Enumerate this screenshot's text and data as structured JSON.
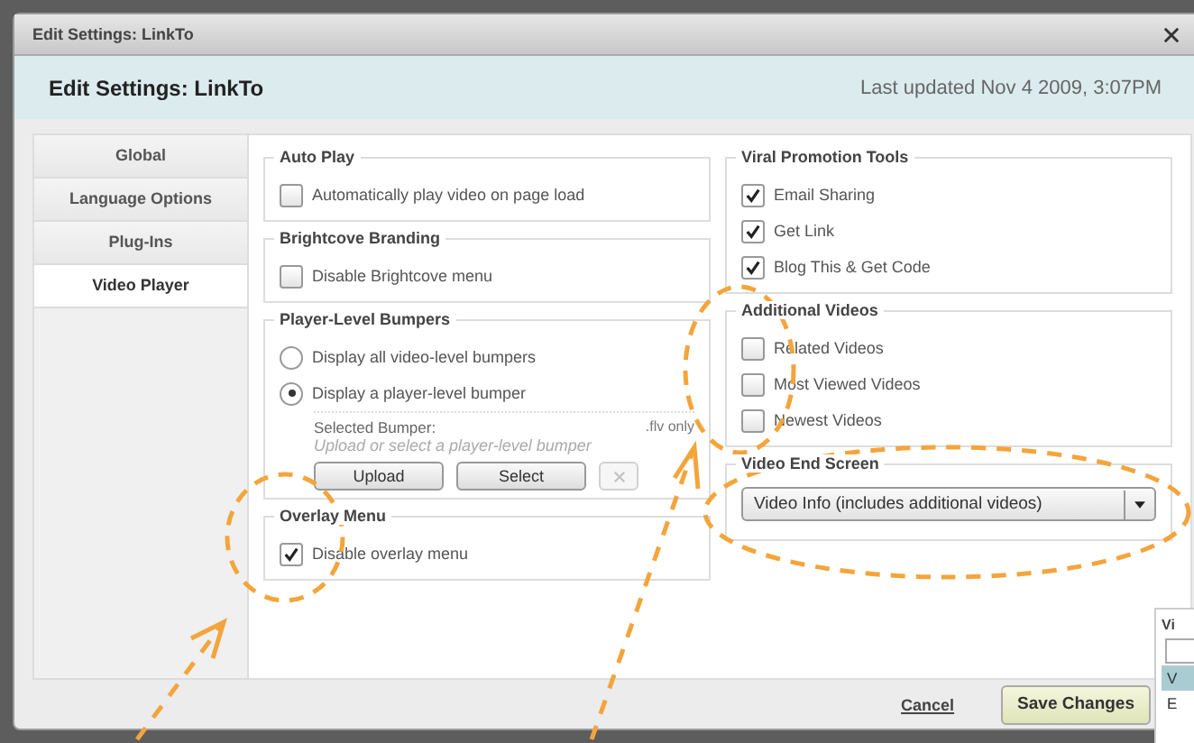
{
  "dialog": {
    "title_bar": "Edit Settings: LinkTo",
    "heading": "Edit Settings: LinkTo",
    "last_updated": "Last updated Nov 4 2009, 3:07PM"
  },
  "tabs": [
    {
      "label": "Global",
      "selected": false
    },
    {
      "label": "Language Options",
      "selected": false
    },
    {
      "label": "Plug-Ins",
      "selected": false
    },
    {
      "label": "Video Player",
      "selected": true
    }
  ],
  "columns": [
    [
      {
        "kind": "checkboxes",
        "title": "Auto Play",
        "items": [
          {
            "label": "Automatically play video on page load",
            "checked": false
          }
        ]
      },
      {
        "kind": "checkboxes",
        "title": "Brightcove Branding",
        "items": [
          {
            "label": "Disable Brightcove menu",
            "checked": false
          }
        ]
      },
      {
        "kind": "radios",
        "title": "Player-Level Bumpers",
        "items": [
          {
            "label": "Display all video-level bumpers",
            "selected": false
          },
          {
            "label": "Display a player-level bumper",
            "selected": true
          }
        ],
        "bumper": {
          "label": "Selected Bumper:",
          "note": ".flv only",
          "placeholder": "Upload or select a player-level bumper",
          "buttons": [
            "Upload",
            "Select"
          ],
          "clear_disabled": true
        }
      },
      {
        "kind": "checkboxes",
        "title": "Overlay Menu",
        "items": [
          {
            "label": "Disable overlay menu",
            "checked": true
          }
        ]
      }
    ],
    [
      {
        "kind": "checkboxes",
        "title": "Viral Promotion Tools",
        "items": [
          {
            "label": "Email Sharing",
            "checked": true
          },
          {
            "label": "Get Link",
            "checked": true
          },
          {
            "label": "Blog This & Get Code",
            "checked": true
          }
        ]
      },
      {
        "kind": "checkboxes",
        "title": "Additional Videos",
        "items": [
          {
            "label": "Related Videos",
            "checked": false
          },
          {
            "label": "Most Viewed Videos",
            "checked": false
          },
          {
            "label": "Newest Videos",
            "checked": false
          }
        ]
      },
      {
        "kind": "select",
        "title": "Video End Screen",
        "value": "Video Info (includes additional videos)"
      }
    ]
  ],
  "footer": {
    "cancel": "Cancel",
    "save": "Save Changes"
  },
  "side_panel": {
    "legend": "Vi",
    "options": [
      {
        "label": "V",
        "selected": true
      },
      {
        "label": "E",
        "selected": false
      }
    ]
  }
}
